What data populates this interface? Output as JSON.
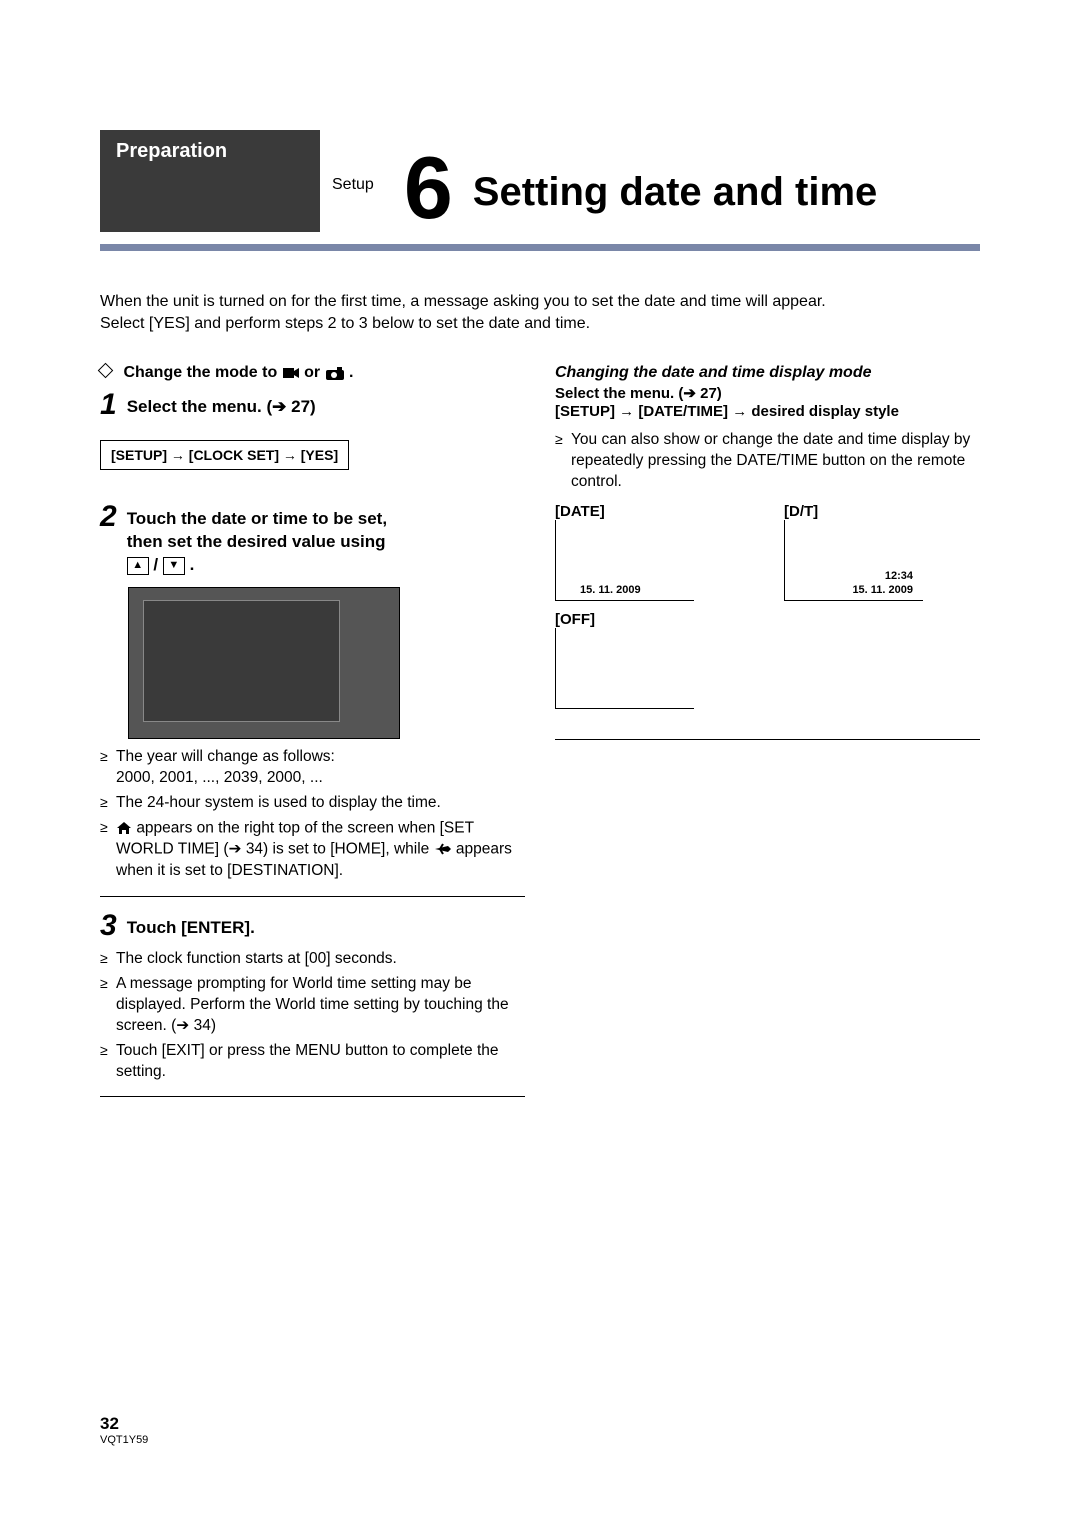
{
  "header": {
    "preparation": "Preparation",
    "setup": "Setup",
    "chapter_num": "6",
    "title": "Setting date and time"
  },
  "intro": {
    "line1": "When the unit is turned on for the first time, a message asking you to set the date and time will appear.",
    "line2": "Select [YES] and perform steps 2 to 3 below to set the date and time."
  },
  "left": {
    "change_mode_pre": "Change the mode to ",
    "change_mode_or": " or ",
    "change_mode_post": " .",
    "step1_num": "1",
    "step1_text": "Select the menu. (➔ 27)",
    "menu_path": "[SETUP] → [CLOCK SET] → [YES]",
    "step2_num": "2",
    "step2_text_l1": "Touch the date or time to be set,",
    "step2_text_l2": "then set the desired value using",
    "step2_text_l3": " / ",
    "step2_text_l3_end": " .",
    "bullets1": [
      "The year will change as follows:\n2000, 2001, ..., 2039, 2000, ...",
      "The 24-hour system is used to display the time."
    ],
    "bullet_home_pre": "",
    "bullet_home_text": " appears on the right top of the screen when [SET WORLD TIME] (➔ 34) is set to [HOME], while ",
    "bullet_home_text2": " appears when it is set to [DESTINATION].",
    "step3_num": "3",
    "step3_text": "Touch [ENTER].",
    "bullets3": [
      "The clock function starts at [00] seconds.",
      "A message prompting for World time setting may be displayed. Perform the World time setting by touching the screen. (➔ 34)",
      "Touch [EXIT] or press the MENU button to complete the setting."
    ]
  },
  "right": {
    "subheading": "Changing the date and time display mode",
    "select_menu": "Select the menu. (➔ 27)",
    "menu_path": "[SETUP] → [DATE/TIME] → desired display style",
    "bullet": "You can also show or change the date and time display by repeatedly pressing the DATE/TIME button on the remote control.",
    "mode_date_label": "[DATE]",
    "mode_dt_label": "[D/T]",
    "mode_off_label": "[OFF]",
    "date_stamp": "15. 11. 2009",
    "time_stamp": "12:34"
  },
  "footer": {
    "page": "32",
    "code": "VQT1Y59"
  }
}
